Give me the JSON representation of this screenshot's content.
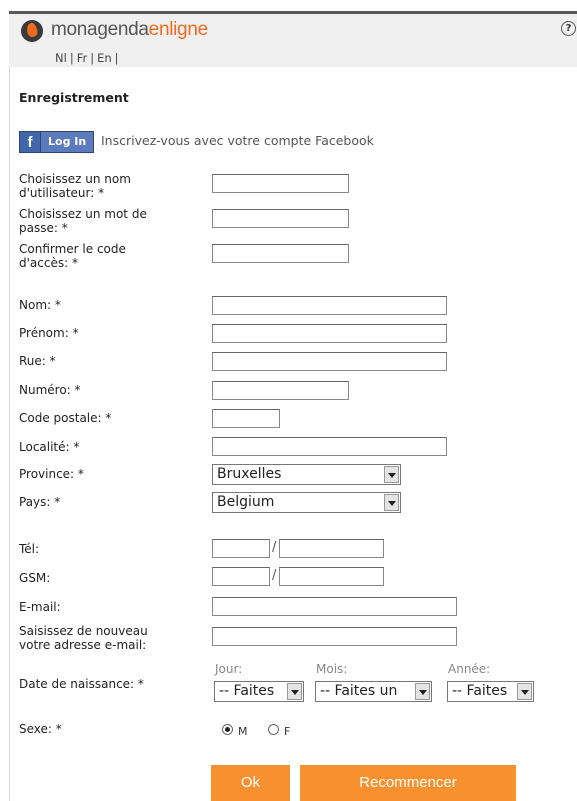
{
  "header": {
    "logo_part1": "monagenda",
    "logo_part2": "enligne",
    "help": "?",
    "languages": [
      "Nl",
      "Fr",
      "En"
    ],
    "lang_separator": "|"
  },
  "page_title": "Enregistrement",
  "facebook": {
    "f": "f",
    "button_label": "Log In",
    "text": "Inscrivez-vous avec votre compte Facebook"
  },
  "fields": {
    "username": {
      "label1": "Choisissez un nom",
      "label2": "d'utilisateur: *",
      "value": ""
    },
    "password": {
      "label1": "Choisissez un mot de",
      "label2": "passe: *",
      "value": ""
    },
    "confirm": {
      "label1": "Confirmer le code",
      "label2": "d'accès: *",
      "value": ""
    },
    "nom": {
      "label": "Nom: *",
      "value": ""
    },
    "prenom": {
      "label": "Prénom: *",
      "value": ""
    },
    "rue": {
      "label": "Rue: *",
      "value": ""
    },
    "numero": {
      "label": "Numéro: *",
      "value": ""
    },
    "code_postale": {
      "label": "Code postale: *",
      "value": ""
    },
    "localite": {
      "label": "Localité: *",
      "value": ""
    },
    "province": {
      "label": "Province: *",
      "selected": "Bruxelles"
    },
    "pays": {
      "label": "Pays: *",
      "selected": "Belgium"
    },
    "tel": {
      "label": "Tél:",
      "slash": "/"
    },
    "gsm": {
      "label": "GSM:",
      "slash": "/"
    },
    "email": {
      "label": "E-mail:",
      "value": ""
    },
    "email_confirm": {
      "label1": "Saisissez de nouveau",
      "label2": "votre adresse e-mail:",
      "value": ""
    },
    "birthdate": {
      "label": "Date de naissance: *",
      "jour_label": "Jour:",
      "mois_label": "Mois:",
      "annee_label": "Année:",
      "jour_selected": "-- Faites",
      "mois_selected": "-- Faites un",
      "annee_selected": "-- Faites"
    },
    "sexe": {
      "label": "Sexe: *",
      "option_m": "M",
      "option_f": "F",
      "selected": "M"
    }
  },
  "buttons": {
    "ok": "Ok",
    "reset": "Recommencer"
  },
  "colors": {
    "accent": "#f7912f",
    "facebook": "#4267a8",
    "brand": "#f06b1f"
  }
}
